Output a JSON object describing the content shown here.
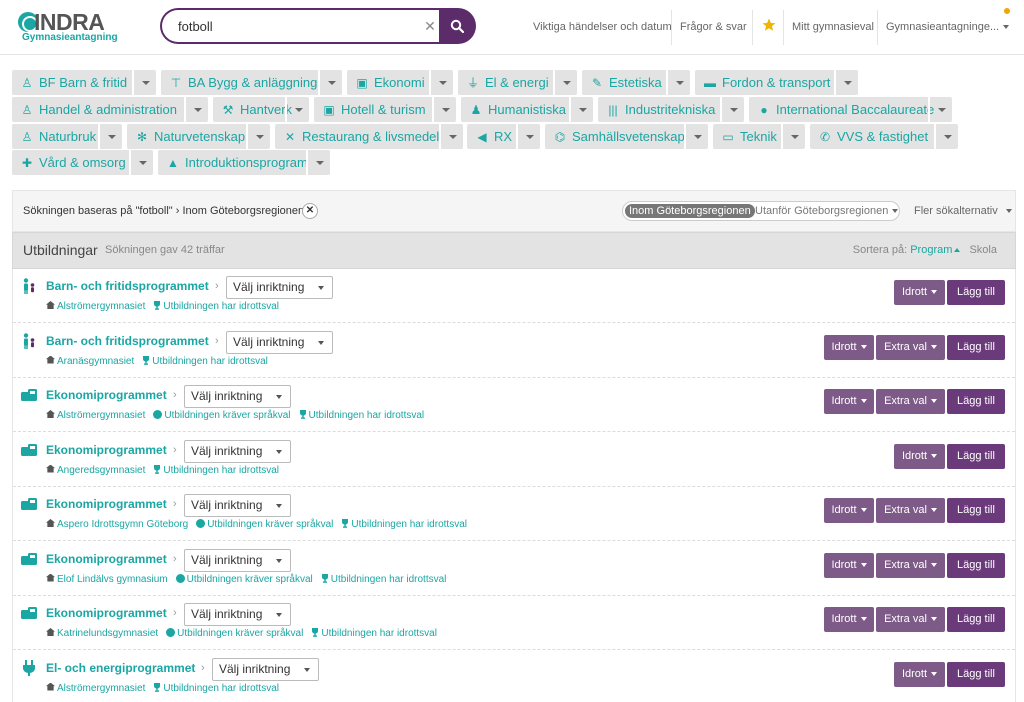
{
  "header": {
    "logo_text": "INDRA",
    "logo_sub": "Gymnasieantagning",
    "search_value": "fotboll",
    "nav": {
      "events": "Viktiga händelser och datum",
      "faq": "Frågor & svar",
      "my_choice": "Mitt gymnasieval",
      "account": "Gymnasieantagninge..."
    }
  },
  "categories": [
    {
      "label": "BF Barn & fritid",
      "icon": "people-icon"
    },
    {
      "label": "BA Bygg & anläggning",
      "icon": "crane-icon"
    },
    {
      "label": "Ekonomi",
      "icon": "briefcase-icon"
    },
    {
      "label": "El & energi",
      "icon": "plug-icon"
    },
    {
      "label": "Estetiska",
      "icon": "paint-icon"
    },
    {
      "label": "Fordon & transport",
      "icon": "truck-icon"
    },
    {
      "label": "Handel & administration",
      "icon": "shop-icon"
    },
    {
      "label": "Hantverk",
      "icon": "tool-icon"
    },
    {
      "label": "Hotell & turism",
      "icon": "suitcase-icon"
    },
    {
      "label": "Humanistiska",
      "icon": "people-icon"
    },
    {
      "label": "Industritekniska",
      "icon": "barcode-icon"
    },
    {
      "label": "International Baccalaureate",
      "icon": "globe-icon"
    },
    {
      "label": "Naturbruk",
      "icon": "farmer-icon"
    },
    {
      "label": "Naturvetenskap",
      "icon": "atom-icon"
    },
    {
      "label": "Restaurang & livsmedel",
      "icon": "cutlery-icon"
    },
    {
      "label": "RX",
      "icon": "megaphone-icon"
    },
    {
      "label": "Samhällsvetenskap",
      "icon": "handshake-icon"
    },
    {
      "label": "Teknik",
      "icon": "laptop-icon"
    },
    {
      "label": "VVS & fastighet",
      "icon": "wrench-icon"
    },
    {
      "label": "Vård & omsorg",
      "icon": "care-icon"
    },
    {
      "label": "Introduktionsprogram",
      "icon": "thumbs-up-icon"
    }
  ],
  "filter": {
    "text": "Sökningen baseras på \"fotboll\" › Inom Göteborgsregionen",
    "region_active": "Inom Göteborgsregionen",
    "region_other": "Utanför Göteborgsregionen",
    "more": "Fler sökalternativ"
  },
  "results": {
    "title": "Utbildningar",
    "count": "Sökningen gav 42 träffar",
    "sort_label": "Sortera på:",
    "sort_program": "Program",
    "sort_school": "Skola"
  },
  "select_label": "Välj inriktning",
  "btn": {
    "idrott": "Idrott",
    "extra": "Extra val",
    "add": "Lägg till"
  },
  "rows": [
    {
      "title": "Barn- och fritidsprogrammet",
      "school": "Alströmergymnasiet",
      "attrs": [
        "Utbildningen har idrottsval"
      ],
      "extra": false
    },
    {
      "title": "Barn- och fritidsprogrammet",
      "school": "Aranäsgymnasiet",
      "attrs": [
        "Utbildningen har idrottsval"
      ],
      "extra": true
    },
    {
      "title": "Ekonomiprogrammet",
      "school": "Alströmergymnasiet",
      "attrs": [
        "Utbildningen kräver språkval",
        "Utbildningen har idrottsval"
      ],
      "extra": true
    },
    {
      "title": "Ekonomiprogrammet",
      "school": "Angeredsgymnasiet",
      "attrs": [
        "Utbildningen har idrottsval"
      ],
      "extra": false
    },
    {
      "title": "Ekonomiprogrammet",
      "school": "Aspero Idrottsgymn Göteborg",
      "attrs": [
        "Utbildningen kräver språkval",
        "Utbildningen har idrottsval"
      ],
      "extra": true
    },
    {
      "title": "Ekonomiprogrammet",
      "school": "Elof Lindälvs gymnasium",
      "attrs": [
        "Utbildningen kräver språkval",
        "Utbildningen har idrottsval"
      ],
      "extra": true
    },
    {
      "title": "Ekonomiprogrammet",
      "school": "Katrinelundsgymnasiet",
      "attrs": [
        "Utbildningen kräver språkval",
        "Utbildningen har idrottsval"
      ],
      "extra": true
    },
    {
      "title": "El- och energiprogrammet",
      "school": "Alströmergymnasiet",
      "attrs": [
        "Utbildningen har idrottsval"
      ],
      "extra": false
    }
  ]
}
